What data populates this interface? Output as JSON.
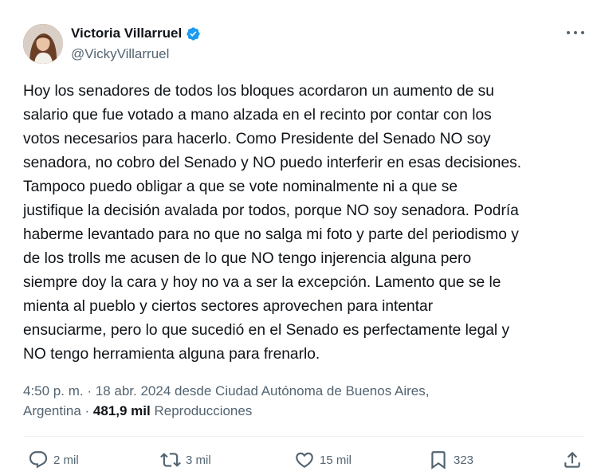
{
  "author": {
    "name": "Victoria Villarruel",
    "handle": "@VickyVillarruel",
    "verified_color": "#1d9bf0",
    "avatar_icon": "profile-photo"
  },
  "menu_icon": "more-horizontal-icon",
  "tweet": {
    "text": "Hoy los senadores de todos los bloques acordaron un aumento de su\nsalario que fue votado a mano alzada en el recinto por contar con los\nvotos necesarios para hacerlo. Como Presidente del Senado NO soy\nsenadora, no cobro del Senado y NO puedo interferir en esas decisiones.\nTampoco puedo obligar a que se vote nominalmente ni a que se\njustifique la decisión avalada por todos, porque NO soy senadora. Podría\nhaberme levantado para no que no salga mi foto y parte del periodismo y\nde los trolls me acusen de lo que NO tengo injerencia alguna pero\nsiempre doy la cara y hoy no va a ser la excepción. Lamento que se le\nmienta al pueblo y ciertos sectores aprovechen para intentar\nensuciarme, pero lo que sucedió en el Senado es perfectamente legal y\nNO tengo herramienta alguna para frenarlo."
  },
  "meta": {
    "time": "4:50 p. m.",
    "separator": "·",
    "date_location": "18 abr. 2024 desde Ciudad Autónoma de Buenos Aires,",
    "country": "Argentina",
    "views_count": "481,9 mil",
    "views_label": "Reproducciones"
  },
  "actions": {
    "replies": "2 mil",
    "retweets": "3 mil",
    "likes": "15 mil",
    "bookmarks": "323"
  },
  "colors": {
    "text": "#0f1419",
    "secondary": "#536471",
    "accent": "#1d9bf0",
    "divider": "#eff3f4"
  }
}
